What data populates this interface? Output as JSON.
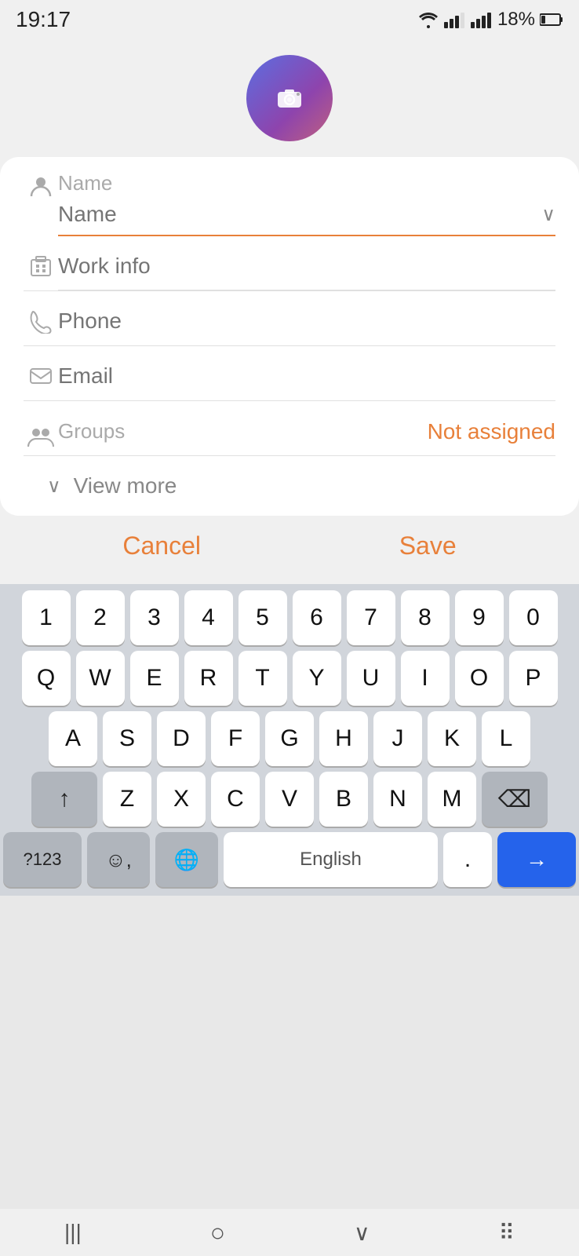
{
  "statusBar": {
    "time": "19:17",
    "batteryPercent": "18%"
  },
  "avatar": {
    "cameraLabel": "camera"
  },
  "form": {
    "nameLabel": "Name",
    "namePlaceholder": "Name",
    "nameChevron": "∨",
    "workInfoLabel": "Work info",
    "phoneLabel": "Phone",
    "emailLabel": "Email",
    "groupsLabel": "Groups",
    "groupsValue": "Not assigned",
    "viewMoreLabel": "View more"
  },
  "actions": {
    "cancelLabel": "Cancel",
    "saveLabel": "Save"
  },
  "keyboard": {
    "row1": [
      "1",
      "2",
      "3",
      "4",
      "5",
      "6",
      "7",
      "8",
      "9",
      "0"
    ],
    "row2": [
      "Q",
      "W",
      "E",
      "R",
      "T",
      "Y",
      "U",
      "I",
      "O",
      "P"
    ],
    "row3": [
      "A",
      "S",
      "D",
      "F",
      "G",
      "H",
      "J",
      "K",
      "L"
    ],
    "row4": [
      "Z",
      "X",
      "C",
      "V",
      "B",
      "N",
      "M"
    ],
    "spaceLabel": "English",
    "specialLeft": "?123",
    "dotLabel": "."
  },
  "navBar": {
    "backIcon": "|||",
    "homeIcon": "○",
    "downIcon": "∨",
    "gridIcon": "⠿"
  }
}
